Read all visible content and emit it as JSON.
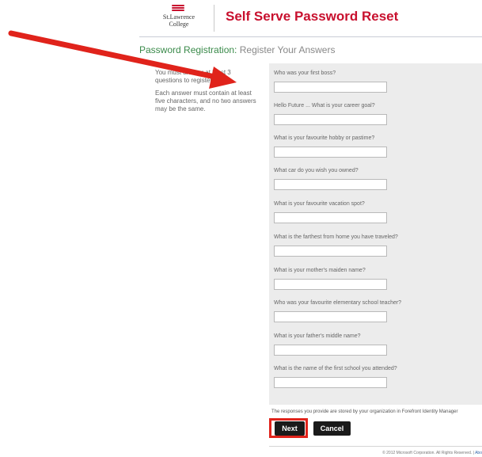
{
  "header": {
    "logo_line1": "St.Lawrence",
    "logo_line2": "College",
    "app_title": "Self Serve Password Reset"
  },
  "page": {
    "title_key": "Password Registration:",
    "title_sub": "Register Your Answers"
  },
  "instructions": {
    "line1": "You must answer at least 3 questions to register.",
    "line2": "Each answer must contain at least five characters, and no two answers may be the same."
  },
  "questions": [
    {
      "label": "Who was your first boss?",
      "value": ""
    },
    {
      "label": "Hello Future ... What is your career goal?",
      "value": ""
    },
    {
      "label": "What is your favourite hobby or pastime?",
      "value": ""
    },
    {
      "label": "What car do you wish you owned?",
      "value": ""
    },
    {
      "label": "What is your favourite vacation spot?",
      "value": ""
    },
    {
      "label": "What is the farthest from home you have traveled?",
      "value": ""
    },
    {
      "label": "What is your mother's maiden name?",
      "value": ""
    },
    {
      "label": "Who was your favourite elementary school teacher?",
      "value": ""
    },
    {
      "label": "What is your father's middle name?",
      "value": ""
    },
    {
      "label": "What is the name of the first school you attended?",
      "value": ""
    }
  ],
  "footnote": "The responses you provide are stored by your organization in Forefront Identity Manager",
  "buttons": {
    "next": "Next",
    "cancel": "Cancel"
  },
  "footer": {
    "copyright": "© 2012 Microsoft Corporation. All Rights Reserved.",
    "separator": "|",
    "about": "Abo"
  },
  "colors": {
    "brand_red": "#c8102e",
    "annotation_red": "#e0231b",
    "title_green": "#3a8a4a",
    "panel_gray": "#ececec"
  },
  "icons": {
    "annotation_arrow": "arrow-pointer-icon",
    "logo_mark": "college-logo-icon"
  }
}
